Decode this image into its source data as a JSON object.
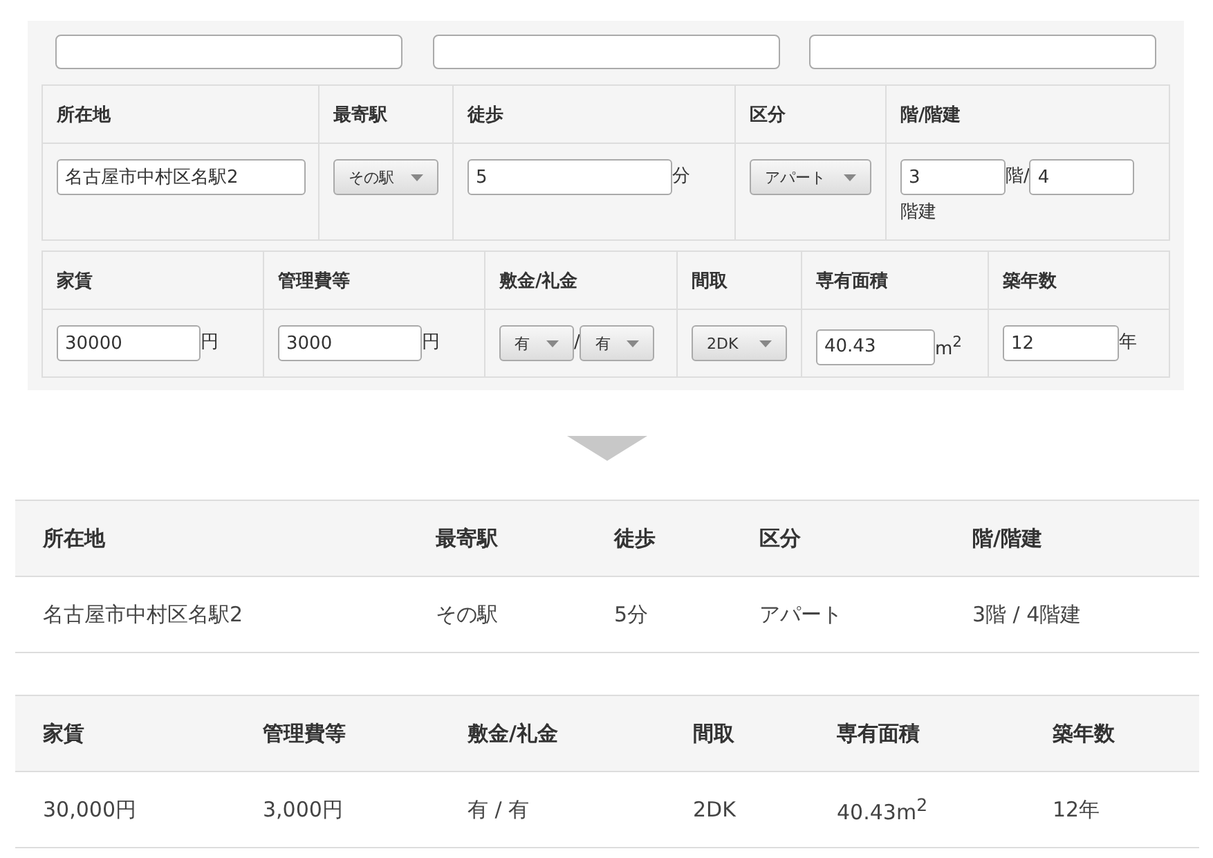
{
  "form": {
    "blank_fields": [
      {
        "kind": "text"
      },
      {
        "kind": "text"
      },
      {
        "kind": "text"
      }
    ],
    "tables": [
      {
        "columns": [
          {
            "header": "所在地",
            "parts": [
              {
                "kind": "input",
                "value": "名古屋市中村区名駅2"
              }
            ]
          },
          {
            "header": "最寄駅",
            "parts": [
              {
                "kind": "select",
                "value": "その駅"
              }
            ]
          },
          {
            "header": "徒歩",
            "parts": [
              {
                "kind": "input",
                "value": "5"
              },
              {
                "kind": "unit",
                "text": "分"
              }
            ]
          },
          {
            "header": "区分",
            "parts": [
              {
                "kind": "select",
                "value": "アパート"
              }
            ]
          },
          {
            "header": "階/階建",
            "parts": [
              {
                "kind": "input",
                "value": "3"
              },
              {
                "kind": "unit",
                "text": "階/"
              },
              {
                "kind": "input",
                "value": "4"
              },
              {
                "kind": "unit",
                "text": "階建"
              }
            ]
          }
        ]
      },
      {
        "columns": [
          {
            "header": "家賃",
            "parts": [
              {
                "kind": "input",
                "value": "30000"
              },
              {
                "kind": "unit",
                "text": "円"
              }
            ]
          },
          {
            "header": "管理費等",
            "parts": [
              {
                "kind": "input",
                "value": "3000"
              },
              {
                "kind": "unit",
                "text": "円"
              }
            ]
          },
          {
            "header": "敷金/礼金",
            "parts": [
              {
                "kind": "select",
                "value": "有"
              },
              {
                "kind": "unit",
                "text": "/"
              },
              {
                "kind": "select",
                "value": "有"
              }
            ]
          },
          {
            "header": "間取",
            "parts": [
              {
                "kind": "select",
                "value": "2DK"
              }
            ]
          },
          {
            "header": "専有面積",
            "parts": [
              {
                "kind": "input",
                "value": "40.43"
              },
              {
                "kind": "unit",
                "text": "m$^{2}$"
              }
            ]
          },
          {
            "header": "築年数",
            "parts": [
              {
                "kind": "input",
                "value": "12"
              },
              {
                "kind": "unit",
                "text": "年"
              }
            ]
          }
        ]
      }
    ]
  },
  "result": {
    "tables": [
      {
        "columns": [
          {
            "header": "所在地",
            "value": "名古屋市中村区名駅2"
          },
          {
            "header": "最寄駅",
            "value": "その駅"
          },
          {
            "header": "徒歩",
            "value": "5分"
          },
          {
            "header": "区分",
            "value": "アパート"
          },
          {
            "header": "階/階建",
            "value": "3階 / 4階建"
          }
        ]
      },
      {
        "columns": [
          {
            "header": "家賃",
            "value": "30,000円"
          },
          {
            "header": "管理費等",
            "value": "3,000円"
          },
          {
            "header": "敷金/礼金",
            "value": "有 / 有"
          },
          {
            "header": "間取",
            "value": "2DK"
          },
          {
            "header": "専有面積",
            "value": "40.43m$^{2}$"
          },
          {
            "header": "築年数",
            "value": "12年"
          }
        ]
      }
    ]
  }
}
